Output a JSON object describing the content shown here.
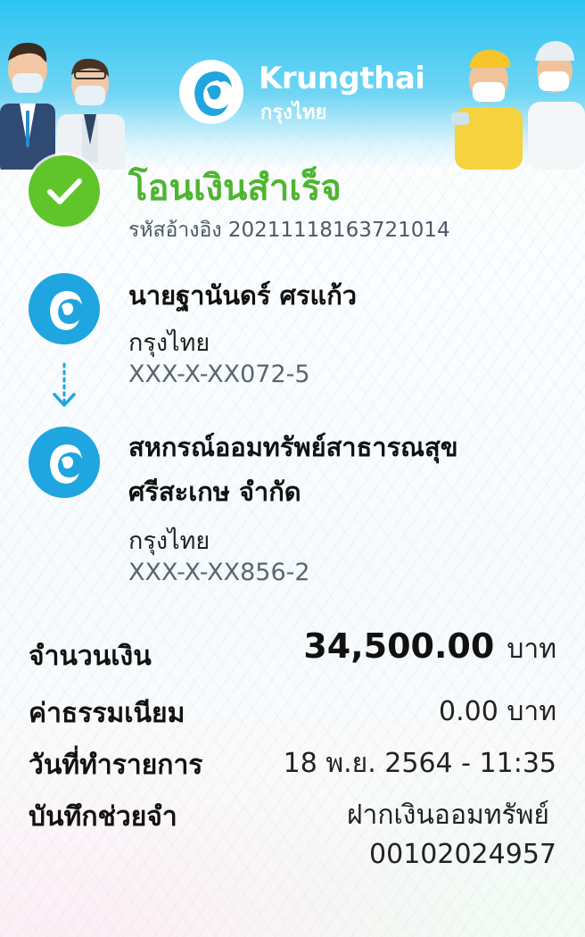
{
  "brand": {
    "name_en": "Krungthai",
    "name_th": "กรุงไทย",
    "primary_color": "#1fa5df",
    "success_color": "#5fc52b"
  },
  "status": {
    "title": "โอนเงินสำเร็จ",
    "reference": "รหัสอ้างอิง 2021111816372101​4"
  },
  "sender": {
    "name": "นายฐานันดร์ ศรแก้ว",
    "bank": "กรุงไทย",
    "account": "XXX-X-XX072-5",
    "icon": "krungthai-logo-icon"
  },
  "receiver": {
    "name_line1": "สหกรณ์ออมทรัพย์สาธารณสุข",
    "name_line2": "ศรีสะเกษ จำกัด",
    "bank": "กรุงไทย",
    "account": "XXX-X-XX856-2",
    "icon": "krungthai-logo-icon"
  },
  "details": {
    "amount_label": "จำนวนเงิน",
    "amount_value": "34,500.00",
    "amount_unit": "บาท",
    "fee_label": "ค่าธรรมเนียม",
    "fee_value": "0.00 บาท",
    "date_label": "วันที่ทำรายการ",
    "date_value": "18 พ.ย. 2564 - 11:35",
    "memo_label": "บันทึกช่วยจำ",
    "memo_line1": "ฝากเงินออมทรัพย์",
    "memo_line2": "00102024957"
  }
}
